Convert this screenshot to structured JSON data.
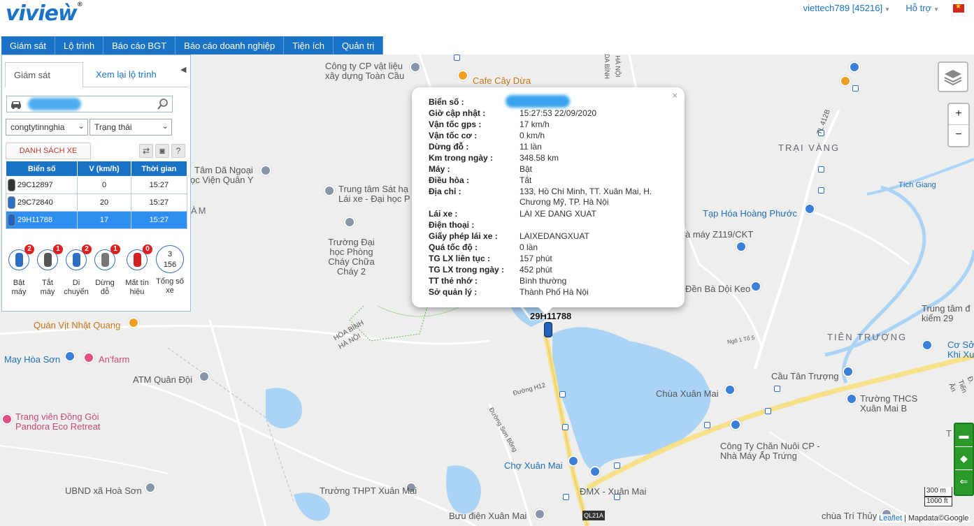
{
  "header": {
    "logo": "vivieẁ",
    "logo_mark": "®",
    "user": "viettech789 [45216]",
    "help": "Hỗ trợ",
    "flag": "★"
  },
  "nav": [
    "Giám sát",
    "Lộ trình",
    "Báo cáo BGT",
    "Báo cáo doanh nghiệp",
    "Tiện ích",
    "Quản trị"
  ],
  "panel": {
    "tab_monitor": "Giám sát",
    "tab_replay": "Xem lại lộ trình",
    "search_placeholder": "",
    "company_select": "congtytinnghia",
    "status_select": "Trạng thái",
    "list_button": "DANH SÁCH XE",
    "columns": [
      "Biển số",
      "V (km/h)",
      "Thời gian"
    ],
    "rows": [
      {
        "plate": "29C12897",
        "speed": "0",
        "time": "15:27"
      },
      {
        "plate": "29C72840",
        "speed": "20",
        "time": "15:27"
      },
      {
        "plate": "29H11788",
        "speed": "17",
        "time": "15:27"
      }
    ],
    "stats": [
      {
        "count": "2",
        "label1": "Bật",
        "label2": "máy",
        "color": "#2d6fc2"
      },
      {
        "count": "1",
        "label1": "Tắt",
        "label2": "máy",
        "color": "#555555"
      },
      {
        "count": "2",
        "label1": "Di",
        "label2": "chuyển",
        "color": "#2d6fc2"
      },
      {
        "count": "1",
        "label1": "Dừng",
        "label2": "đỗ",
        "color": "#777777"
      },
      {
        "count": "0",
        "label1": "Mất tín",
        "label2": "hiệu",
        "color": "#d02020"
      }
    ],
    "total": {
      "a": "3",
      "b": "156",
      "label1": "Tổng số",
      "label2": "xe"
    }
  },
  "popup": {
    "close": "×",
    "rows": [
      {
        "k": "Biển số :",
        "v": ""
      },
      {
        "k": "Giờ cập nhật :",
        "v": "15:27:53 22/09/2020"
      },
      {
        "k": "Vận tốc gps :",
        "v": "17   km/h"
      },
      {
        "k": "Vận tốc cơ :",
        "v": "0   km/h"
      },
      {
        "k": "Dừng đỗ :",
        "v": "11 lần"
      },
      {
        "k": "Km trong ngày :",
        "v": "348.58  km"
      },
      {
        "k": "Máy :",
        "v": "Bật"
      },
      {
        "k": "Điều hòa :",
        "v": "Tắt"
      },
      {
        "k": "Địa chỉ :",
        "v": "133, Hồ Chí Minh, TT. Xuân Mai, H. Chương Mỹ, TP. Hà Nội"
      },
      {
        "k": "Lái xe :",
        "v": "LAI XE DANG XUAT"
      },
      {
        "k": "Điện thoại :",
        "v": ""
      },
      {
        "k": "Giấy phép lái xe :",
        "v": "LAIXEDANGXUAT"
      },
      {
        "k": "Quá tốc độ :",
        "v": "0 lần"
      },
      {
        "k": "TG LX liên tục :",
        "v": "157 phút"
      },
      {
        "k": "TG LX trong ngày :",
        "v": "452 phút"
      },
      {
        "k": "TT thẻ nhớ :",
        "v": "Bình thường"
      },
      {
        "k": "Sở quản lý :",
        "v": "Thành Phố Hà Nội"
      }
    ]
  },
  "marker": {
    "plate": "29H11788"
  },
  "map_labels": {
    "l1": "Công ty CP vật liệu xây dựng Toàn Cầu",
    "l2": "Cafe Cây Dừa",
    "l3": "TRẠI VÀNG",
    "l4": "Tâm Dã Ngoại",
    "l5": "ọc Viện Quân Y",
    "l6": "Trung tâm Sát hạ",
    "l7": "Lái xe - Đại học P",
    "l8": "ÀM",
    "l9": "Trường Đại học Phòng Cháy Chữa Cháy 2",
    "l10": "Tạp Hóa Hoàng Phước",
    "l11": "à máy Z119/CKT",
    "l12": "Đền Bà Dội Keo",
    "l13": "Trung tâm đ kiểm 29",
    "l14": "TIÊN TRƯỢNG",
    "l15": "Cơ Sở Khi Xu",
    "l16": "Cầu Tân Trượng",
    "l17": "Trường THCS Xuân Mai B",
    "l18": "Chùa Xuân Mai",
    "l19": "Công Ty Chăn Nuôi CP - Nhà Máy Ấp Trứng",
    "l20": "Chợ Xuân Mai",
    "l21": "ĐMX - Xuân Mai",
    "l22": "Quán Vịt Nhật Quang",
    "l23": "May Hòa Sơn",
    "l24": "An'farm",
    "l25": "ATM Quân Đội",
    "l26": "Trang viên Đồng Gòi Pandora Eco Retreat",
    "l27": "UBND xã Hoà Sơn",
    "l28": "Trường THPT Xuân Mai",
    "l29": "Bưu điện Xuân Mai",
    "l30": "chùa Trí Thủy",
    "l31": "TIÊN",
    "l32": "Tích Giang",
    "l33": "HÒA BÌNH HÀ NỘI",
    "l34": "QL21A",
    "l35": "DA BÌNH",
    "l36": "HÀ NỘI",
    "l37": "TL 412B",
    "l38": "Đường Sơn Bồng",
    "l39": "Đường H12",
    "l40": "Ngõ 1 Tổ 5",
    "l41": "Đ. Tiến Ăn"
  },
  "controls": {
    "zoom_in": "+",
    "zoom_out": "−",
    "scale_m": "300 m",
    "scale_ft": "1000 ft",
    "attrib_leaflet": "Leaflet",
    "attrib_rest": "| Mapdata©Google"
  },
  "colors": {
    "brand": "#1a73c7",
    "selected_row": "#2e8ff0",
    "badge": "#e02020",
    "water": "#aad3f5",
    "road_major": "#f7e08a"
  }
}
